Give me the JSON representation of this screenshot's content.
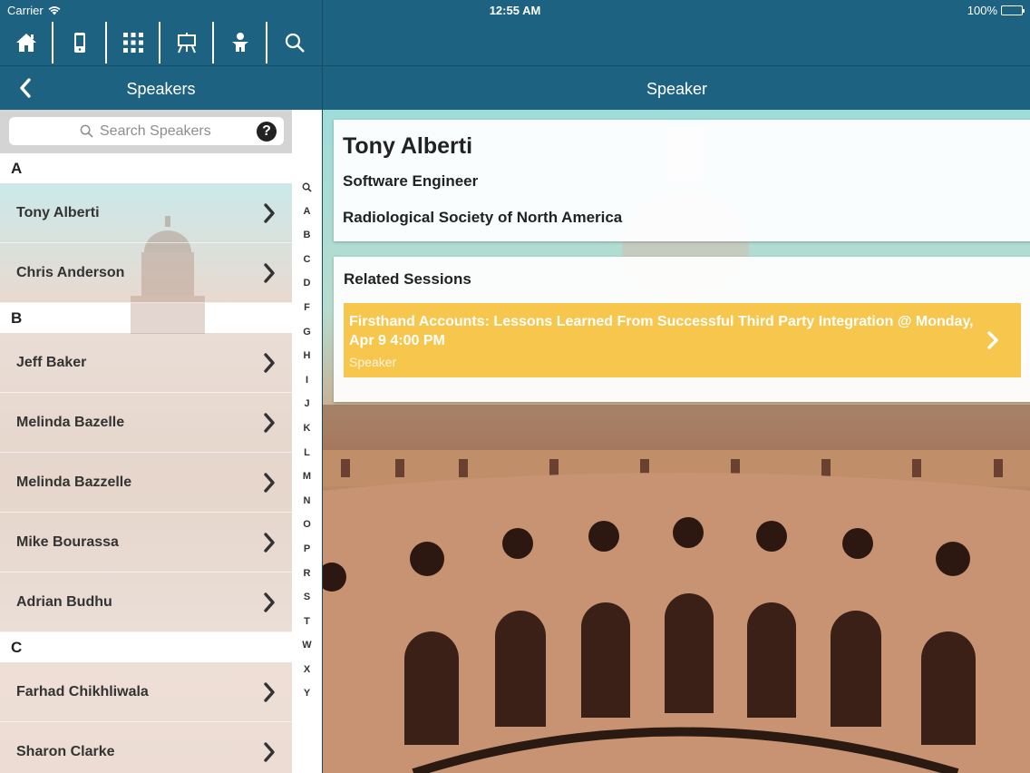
{
  "status": {
    "carrier": "Carrier",
    "time": "12:55 AM",
    "battery": "100%"
  },
  "toolbar": {
    "items": [
      "home-icon",
      "mobile-icon",
      "grid-icon",
      "presentation-icon",
      "person-icon",
      "search-icon"
    ]
  },
  "left_nav": {
    "title": "Speakers"
  },
  "search": {
    "placeholder": "Search Speakers",
    "help_label": "?"
  },
  "sections": [
    {
      "letter": "A",
      "speakers": [
        "Tony Alberti",
        "Chris Anderson"
      ]
    },
    {
      "letter": "B",
      "speakers": [
        "Jeff Baker",
        "Melinda Bazelle",
        "Melinda Bazzelle",
        "Mike Bourassa",
        "Adrian Budhu"
      ]
    },
    {
      "letter": "C",
      "speakers": [
        "Farhad Chikhliwala",
        "Sharon Clarke"
      ]
    }
  ],
  "index": [
    "Q",
    "A",
    "B",
    "C",
    "D",
    "F",
    "G",
    "H",
    "I",
    "J",
    "K",
    "L",
    "M",
    "N",
    "O",
    "P",
    "R",
    "S",
    "T",
    "W",
    "X",
    "Y"
  ],
  "right_nav": {
    "title": "Speaker"
  },
  "speaker": {
    "name": "Tony Alberti",
    "title": "Software Engineer",
    "organization": "Radiological Society of North America"
  },
  "related": {
    "heading": "Related Sessions",
    "sessions": [
      {
        "title": "Firsthand Accounts: Lessons Learned From Successful Third Party Integration @ Monday, Apr 9 4:00 PM",
        "role": "Speaker"
      }
    ]
  },
  "colors": {
    "brand": "#1e6282",
    "session_accent": "#f6c64d"
  }
}
